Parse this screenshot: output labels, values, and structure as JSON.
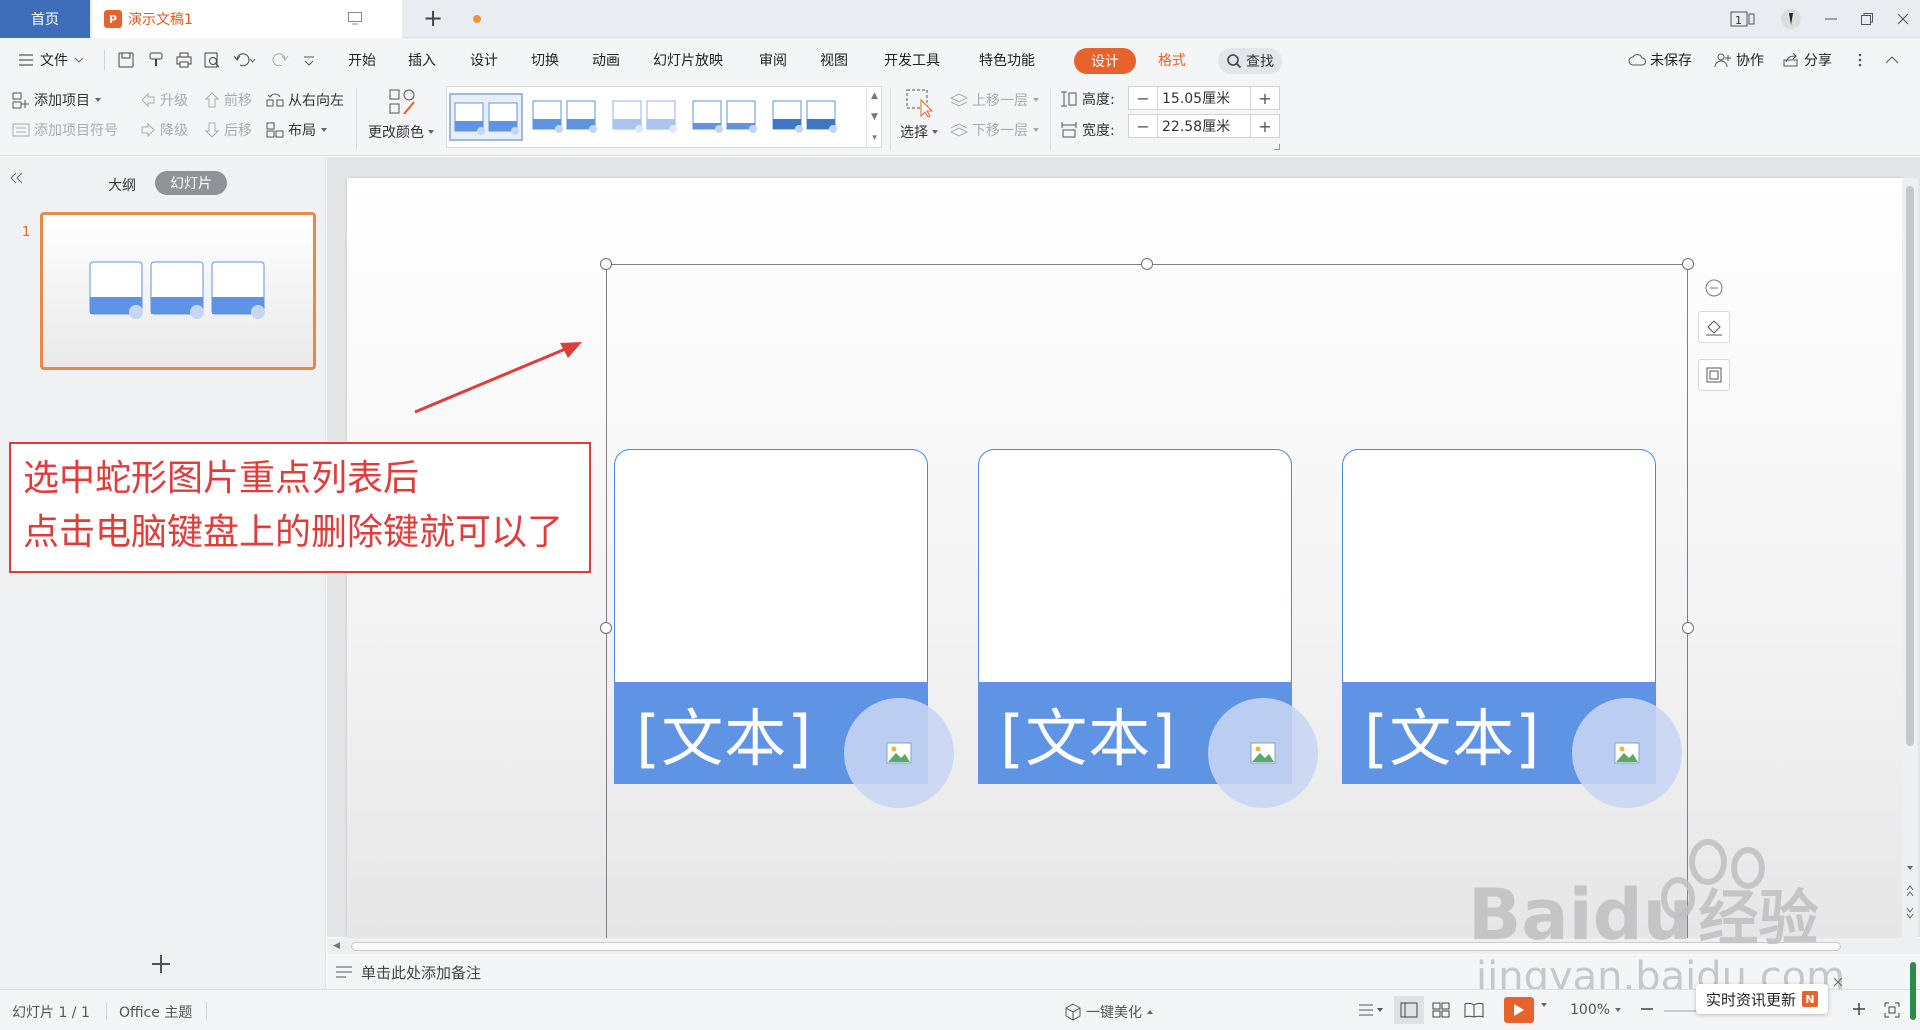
{
  "tabs": {
    "home": "首页",
    "document": "演示文稿1",
    "doc_logo": "P"
  },
  "window": {
    "page_indicator": "1"
  },
  "menu": {
    "file": "文件",
    "items": [
      "开始",
      "插入",
      "设计",
      "切换",
      "动画",
      "幻灯片放映",
      "审阅",
      "视图",
      "开发工具",
      "特色功能"
    ],
    "context_design": "设计",
    "context_format": "格式",
    "search": "查找",
    "unsaved": "未保存",
    "collab": "协作",
    "share": "分享"
  },
  "ribbon": {
    "add_item": "添加项目",
    "add_bullet": "添加项目符号",
    "promote": "升级",
    "demote": "降级",
    "move_up": "前移",
    "move_down": "后移",
    "rtl": "从右向左",
    "layout": "布局",
    "change_color": "更改颜色",
    "select": "选择",
    "bring_forward": "上移一层",
    "send_backward": "下移一层",
    "height_label": "高度:",
    "height_value": "15.05厘米",
    "width_label": "宽度:",
    "width_value": "22.58厘米"
  },
  "panel": {
    "outline_tab": "大纲",
    "slides_tab": "幻灯片",
    "slide_number": "1"
  },
  "slide": {
    "cards": [
      {
        "text": "[文本]"
      },
      {
        "text": "[文本]"
      },
      {
        "text": "[文本]"
      }
    ]
  },
  "annotation": {
    "line1": "选中蛇形图片重点列表后",
    "line2": "点击电脑键盘上的删除键就可以了"
  },
  "notes": {
    "placeholder": "单击此处添加备注"
  },
  "status": {
    "slide_count": "幻灯片 1 / 1",
    "theme": "Office 主题",
    "beautify": "一键美化",
    "zoom": "100%",
    "news": "实时资讯更新"
  },
  "watermark": {
    "brand": "Bai",
    "brand_du": "du",
    "brand_cn": "经验",
    "url": "jingyan.baidu.com"
  },
  "colors": {
    "accent": "#e8622c",
    "home_tab": "#3f6db9",
    "card_blue": "#5e94e3",
    "annotation_red": "#e03c3c"
  }
}
